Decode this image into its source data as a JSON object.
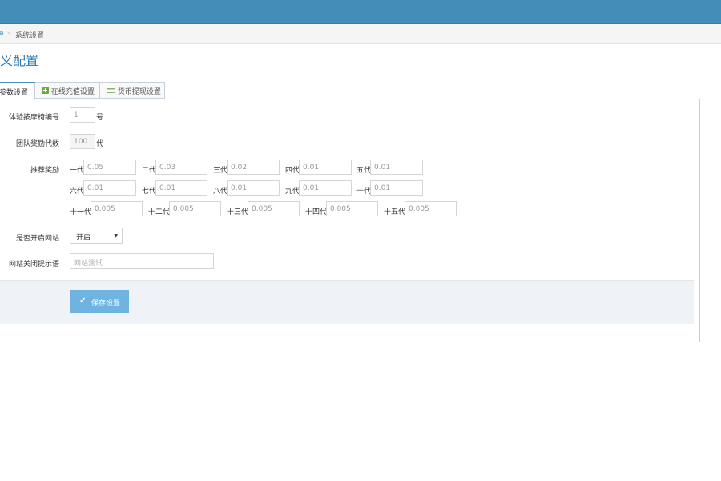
{
  "breadcrumb": {
    "home_fragment": "e",
    "separator": "›",
    "current": "系统设置"
  },
  "page_title": "义配置",
  "tabs": [
    {
      "label": "参数设置",
      "icon": "none",
      "active": true
    },
    {
      "label": "在线充值设置",
      "icon": "plus-square-icon",
      "active": false
    },
    {
      "label": "货币提现设置",
      "icon": "credit-card-icon",
      "active": false
    }
  ],
  "form": {
    "trial_massage_chair": {
      "label": "体验按摩椅编号",
      "value": "1",
      "unit": "号"
    },
    "team_reward_generations": {
      "label": "团队奖励代数",
      "value": "100",
      "unit": "代"
    },
    "referral_reward": {
      "label": "推荐奖励",
      "rows": [
        [
          {
            "gen": "一代",
            "value": "0.05"
          },
          {
            "gen": "二代",
            "value": "0.03"
          },
          {
            "gen": "三代",
            "value": "0.02"
          },
          {
            "gen": "四代",
            "value": "0.01"
          },
          {
            "gen": "五代",
            "value": "0.01"
          }
        ],
        [
          {
            "gen": "六代",
            "value": "0.01"
          },
          {
            "gen": "七代",
            "value": "0.01"
          },
          {
            "gen": "八代",
            "value": "0.01"
          },
          {
            "gen": "九代",
            "value": "0.01"
          },
          {
            "gen": "十代",
            "value": "0.01"
          }
        ],
        [
          {
            "gen": "十一代",
            "value": "0.005"
          },
          {
            "gen": "十二代",
            "value": "0.005"
          },
          {
            "gen": "十三代",
            "value": "0.005"
          },
          {
            "gen": "十四代",
            "value": "0.005"
          },
          {
            "gen": "十五代",
            "value": "0.005"
          }
        ]
      ]
    },
    "site_open": {
      "label": "是否开启网站",
      "selected": "开启"
    },
    "site_closed_message": {
      "label": "网站关闭提示语",
      "placeholder": "网站测试"
    }
  },
  "save_button": {
    "label": "保存设置",
    "icon": "check-icon"
  },
  "colors": {
    "topbar": "#438eb9",
    "accent": "#2679b5",
    "button": "#6fb3e0",
    "tab_active_border": "#4c8fbd",
    "actions_bg": "#eff3f8"
  }
}
